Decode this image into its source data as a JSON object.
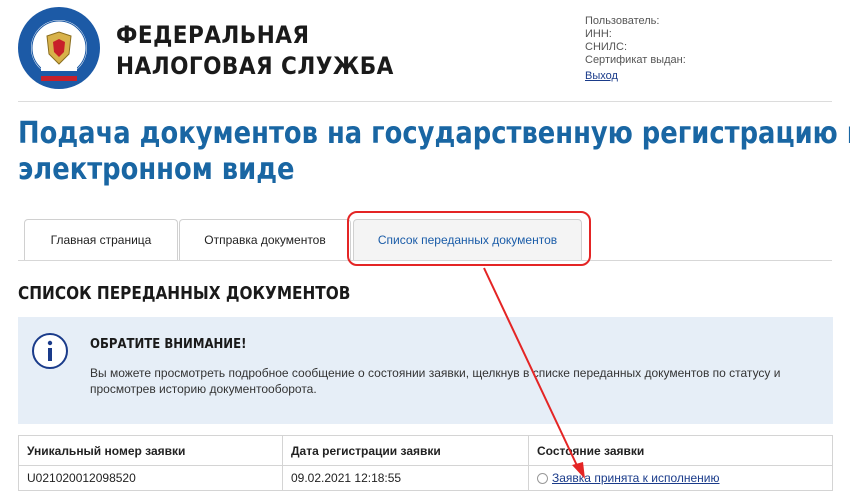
{
  "header": {
    "org_name_line1": "ФЕДЕРАЛЬНАЯ",
    "org_name_line2": "НАЛОГОВАЯ СЛУЖБА",
    "logo_text": "ФЕДЕРАЛЬНАЯ НАЛОГОВАЯ СЛУЖБА",
    "user_label": "Пользователь:",
    "inn_label": "ИНН:",
    "snils_label": "СНИЛС:",
    "cert_label": "Сертификат выдан:",
    "logout_label": "Выход"
  },
  "page": {
    "title_line1": "Подача документов на государственную регистрацию в",
    "title_line2": "электронном виде"
  },
  "tabs": [
    {
      "label": "Главная страница"
    },
    {
      "label": "Отправка документов"
    },
    {
      "label": "Список переданных документов"
    }
  ],
  "section": {
    "title": "СПИСОК ПЕРЕДАННЫХ ДОКУМЕНТОВ"
  },
  "notice": {
    "title": "ОБРАТИТЕ ВНИМАНИЕ!",
    "text": "Вы можете просмотреть подробное сообщение о состоянии заявки, щелкнув в списке переданных документов по статусу и просмотрев историю документооборота."
  },
  "table": {
    "headers": [
      "Уникальный номер заявки",
      "Дата регистрации заявки",
      "Состояние заявки"
    ],
    "rows": [
      {
        "number": "U021020012098520",
        "date": "09.02.2021 12:18:55",
        "status": "Заявка принята к исполнению"
      }
    ]
  },
  "colors": {
    "title_blue": "#1966a3",
    "notice_bg": "#e6eef7",
    "annotation_red": "#e42525",
    "link_blue": "#1a3b8a"
  }
}
